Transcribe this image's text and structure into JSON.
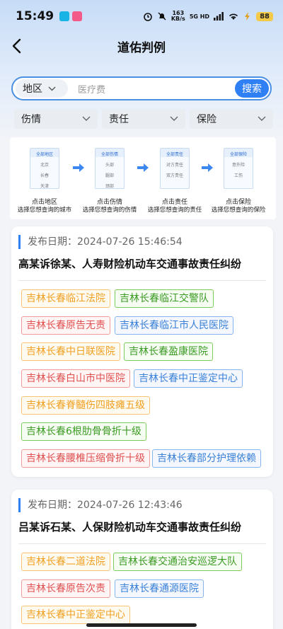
{
  "status": {
    "time": "15:49",
    "net_speed_top": "163",
    "net_speed_bottom": "KB/s",
    "network": "5G HD",
    "battery": "88"
  },
  "nav": {
    "title": "道佑判例"
  },
  "search": {
    "region": "地区",
    "placeholder": "医疗费",
    "button": "搜索"
  },
  "filters": [
    "伤情",
    "责任",
    "保险"
  ],
  "guide": {
    "steps": [
      {
        "header": "全部地区",
        "items": [
          "北京",
          "长春",
          "天津"
        ],
        "caption": "点击地区",
        "desc": "选择您想查询的城市"
      },
      {
        "header": "全部伤情",
        "items": [
          "头部",
          "腿部",
          "颈部"
        ],
        "caption": "点击伤情",
        "desc": "选择您想查询的伤情"
      },
      {
        "header": "全部责任",
        "items": [
          "对方责任",
          "双方责任"
        ],
        "caption": "点击责任",
        "desc": "选择您想查询的责任"
      },
      {
        "header": "全部保险",
        "items": [
          "意外险",
          "工伤"
        ],
        "caption": "点击保险",
        "desc": "选择您想查询的保险"
      }
    ]
  },
  "cards": [
    {
      "date_label": "发布日期：",
      "date": "2024-07-26 15:46:54",
      "title": "高某诉徐某、人寿财险机动车交通事故责任纠纷",
      "tags": [
        {
          "text": "吉林长春临江法院",
          "color": "orange"
        },
        {
          "text": "吉林长春临江交警队",
          "color": "green"
        },
        {
          "text": "吉林长春原告无责",
          "color": "red"
        },
        {
          "text": "吉林长春临江市人民医院",
          "color": "blue"
        },
        {
          "text": "吉林长春中日联医院",
          "color": "orange"
        },
        {
          "text": "吉林长春盈康医院",
          "color": "green"
        },
        {
          "text": "吉林长春白山市中医院",
          "color": "red"
        },
        {
          "text": "吉林长春中正鉴定中心",
          "color": "blue"
        },
        {
          "text": "吉林长春脊髓伤四肢瘫五级",
          "color": "orange"
        },
        {
          "text": "吉林长春6根肋骨骨折十级",
          "color": "green"
        },
        {
          "text": "吉林长春腰椎压缩骨折十级",
          "color": "red"
        },
        {
          "text": "吉林长春部分护理依赖",
          "color": "blue"
        }
      ]
    },
    {
      "date_label": "发布日期：",
      "date": "2024-07-26 12:43:46",
      "title": "吕某诉石某、人保财险机动车交通事故责任纠纷",
      "tags": [
        {
          "text": "吉林长春二道法院",
          "color": "orange"
        },
        {
          "text": "吉林长春交通治安巡逻大队",
          "color": "green"
        },
        {
          "text": "吉林长春原告次责",
          "color": "red"
        },
        {
          "text": "吉林长春通源医院",
          "color": "blue"
        },
        {
          "text": "吉林长春中正鉴定中心",
          "color": "orange"
        }
      ]
    }
  ],
  "colors": {
    "accent": "#2f7ff5"
  }
}
